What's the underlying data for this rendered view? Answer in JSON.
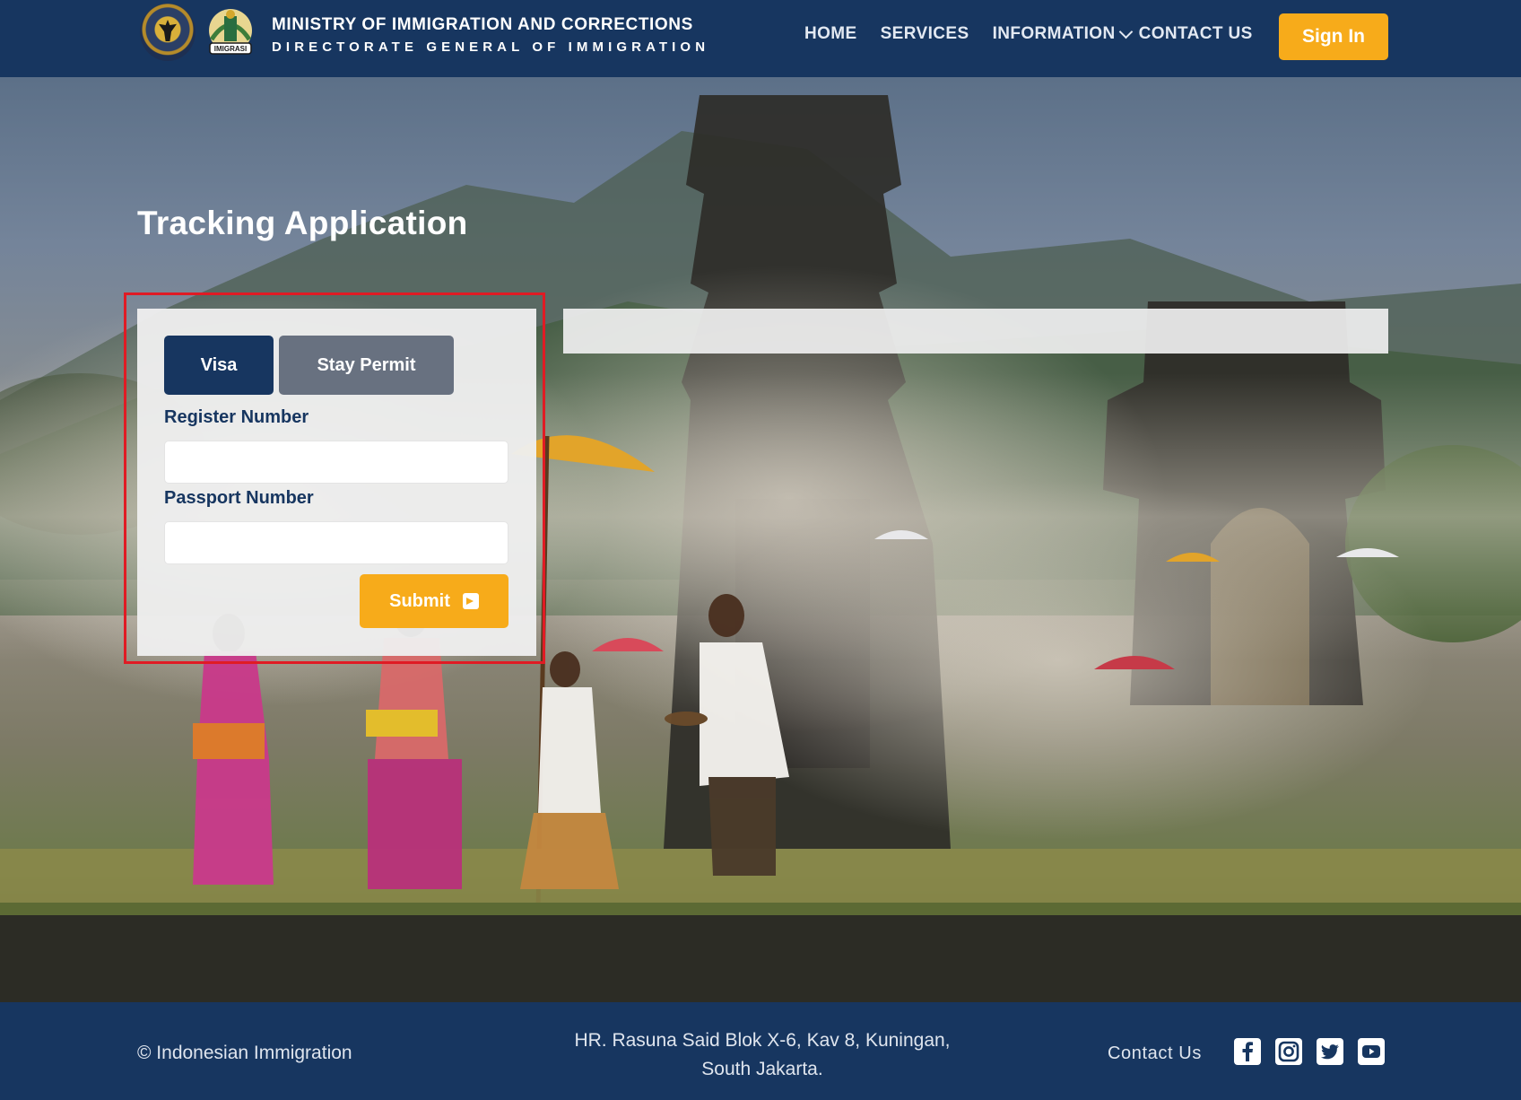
{
  "header": {
    "ministry_line1": "MINISTRY OF IMMIGRATION AND CORRECTIONS",
    "ministry_line2": "DIRECTORATE GENERAL OF IMMIGRATION",
    "logo_imigrasi_text": "IMIGRASI",
    "nav": {
      "home": "HOME",
      "services": "SERVICES",
      "information": "INFORMATION",
      "contact": "CONTACT US"
    },
    "sign_in": "Sign In"
  },
  "main": {
    "title": "Tracking Application",
    "tabs": [
      {
        "label": "Visa",
        "active": true
      },
      {
        "label": "Stay Permit",
        "active": false
      }
    ],
    "register_label": "Register Number",
    "register_value": "",
    "passport_label": "Passport Number",
    "passport_value": "",
    "submit_label": "Submit"
  },
  "footer": {
    "copyright": "© Indonesian Immigration",
    "address_line1": "HR. Rasuna Said Blok X-6, Kav 8, Kuningan,",
    "address_line2": "South Jakarta.",
    "contact": "Contact Us",
    "social_icons": [
      "facebook-icon",
      "instagram-icon",
      "twitter-icon",
      "youtube-icon"
    ]
  },
  "colors": {
    "navy": "#173660",
    "accent": "#f7ab1a",
    "tab_inactive": "#687180",
    "highlight_border": "#e01b24"
  }
}
